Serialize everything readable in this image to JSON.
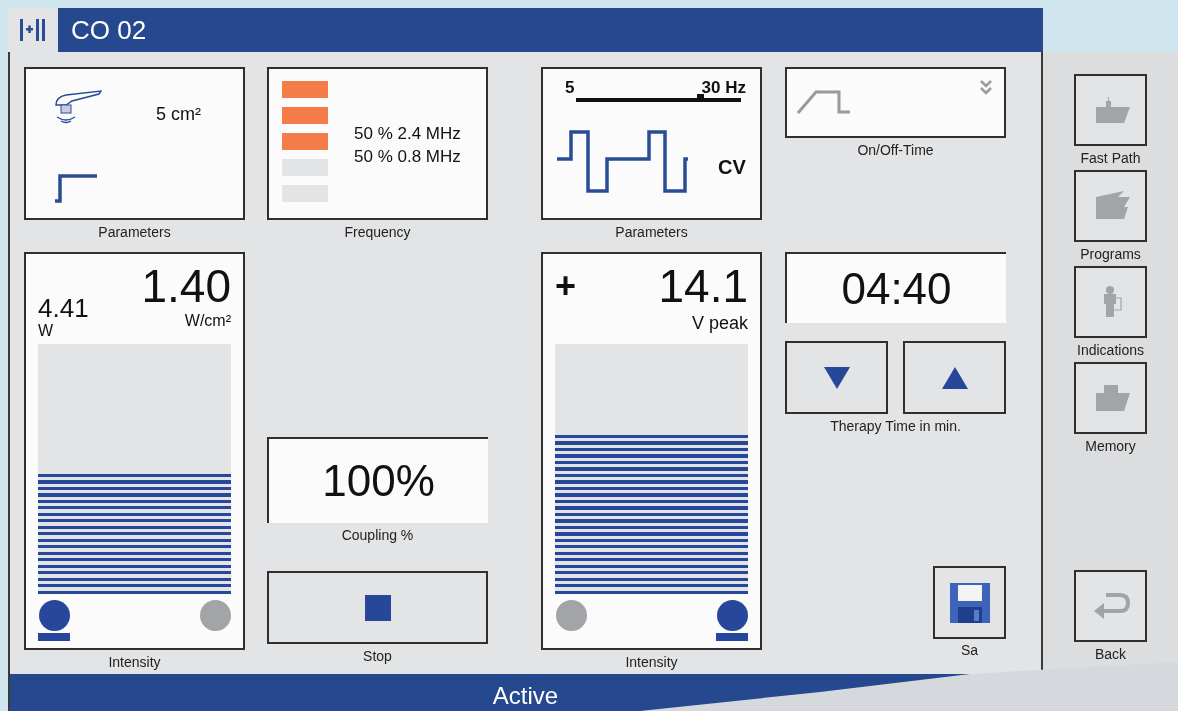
{
  "window": {
    "title": "CO 02"
  },
  "ultrasound": {
    "parameters": {
      "area": "5 cm²",
      "label": "Parameters"
    },
    "frequency": {
      "segments": [
        {
          "on": true
        },
        {
          "on": true
        },
        {
          "on": true
        },
        {
          "on": false
        },
        {
          "on": false
        }
      ],
      "lines": [
        "50 % 2.4 MHz",
        "50 % 0.8 MHz"
      ],
      "label": "Frequency"
    },
    "intensity": {
      "power": "4.41",
      "power_unit": "W",
      "density": "1.40",
      "density_unit": "W/cm²",
      "level": 0.48,
      "heads": [
        {
          "selected": true
        },
        {
          "selected": false
        }
      ],
      "label": "Intensity"
    },
    "coupling": {
      "value": "100%",
      "label": "Coupling %"
    },
    "stop": {
      "label": "Stop"
    }
  },
  "stimulation": {
    "parameters": {
      "min": "5",
      "max": "30 Hz",
      "level": 0.75,
      "mode": "CV",
      "label": "Parameters"
    },
    "on_off": {
      "label": "On/Off-Time"
    },
    "intensity": {
      "polarity": "+",
      "value": "14.1",
      "unit": "V peak",
      "level": 0.64,
      "electrodes": [
        {
          "selected": false
        },
        {
          "selected": true
        }
      ],
      "label": "Intensity"
    },
    "therapy_time": {
      "value": "04:40",
      "label": "Therapy Time in min."
    },
    "save": {
      "label": "Sa"
    }
  },
  "sidebar": {
    "items": [
      {
        "label": "Fast Path",
        "kind": "fastpath"
      },
      {
        "label": "Programs",
        "kind": "programs"
      },
      {
        "label": "Indications",
        "kind": "indications"
      },
      {
        "label": "Memory",
        "kind": "memory"
      }
    ],
    "back": {
      "label": "Back"
    }
  },
  "status_bar": "Active"
}
